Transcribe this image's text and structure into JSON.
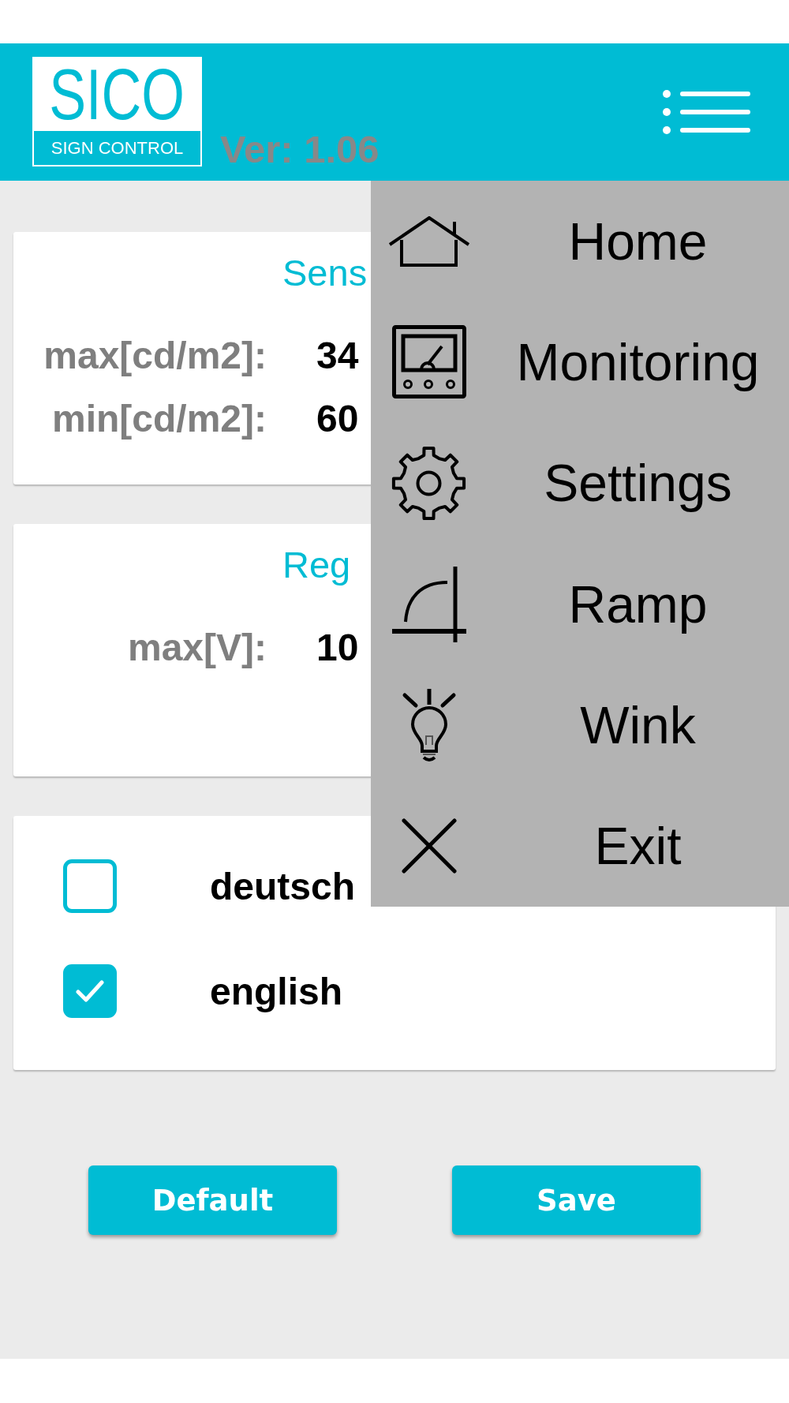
{
  "header": {
    "logo": {
      "title": "SICO",
      "subtitle": "SIGN CONTROL"
    },
    "version": "Ver: 1.06"
  },
  "cards": [
    {
      "title": "Sens",
      "rows": [
        {
          "label": "max[cd/m2]:",
          "value": "34"
        },
        {
          "label": "min[cd/m2]:",
          "value": "60"
        }
      ]
    },
    {
      "title": "Reg",
      "rows": [
        {
          "label": "max[V]:",
          "value": "10"
        }
      ]
    }
  ],
  "languages": [
    {
      "label": "deutsch",
      "checked": false
    },
    {
      "label": "english",
      "checked": true
    }
  ],
  "buttons": [
    {
      "label": "Default"
    },
    {
      "label": "Save"
    }
  ],
  "menu": {
    "items": [
      {
        "kind": "home",
        "label": "Home"
      },
      {
        "kind": "monitor",
        "label": "Monitoring"
      },
      {
        "kind": "settings",
        "label": "Settings"
      },
      {
        "kind": "ramp",
        "label": "Ramp"
      },
      {
        "kind": "bulb",
        "label": "Wink"
      },
      {
        "kind": "close",
        "label": "Exit"
      }
    ]
  }
}
